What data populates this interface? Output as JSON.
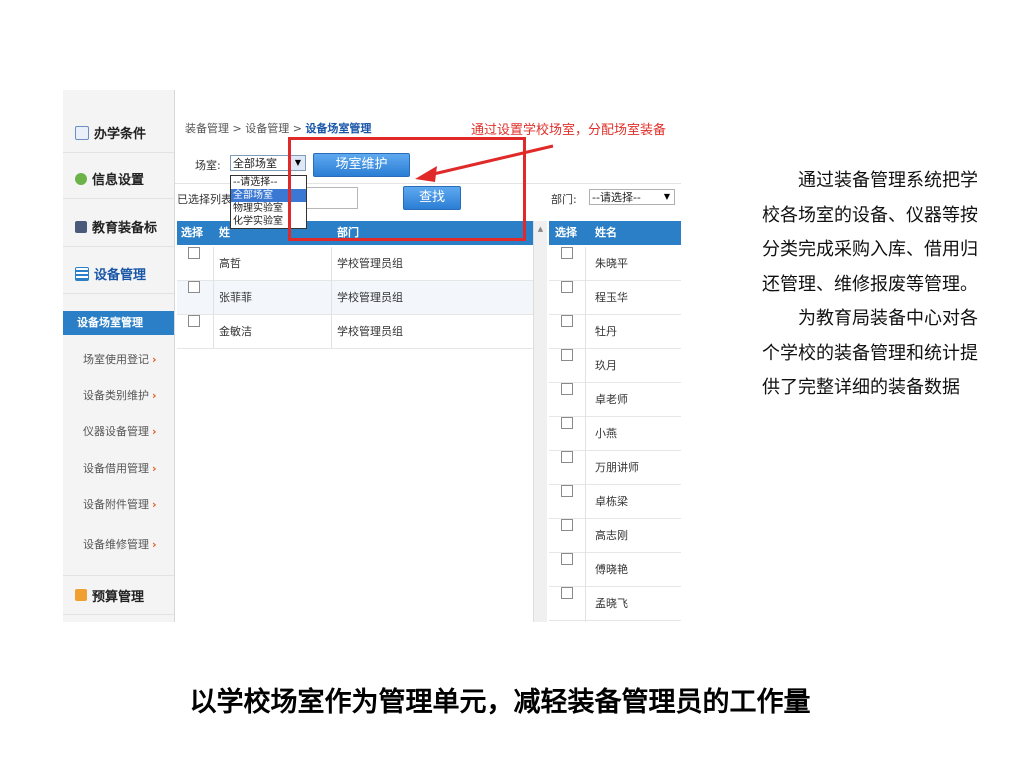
{
  "nav": {
    "sections": [
      "办学条件",
      "信息设置",
      "教育装备标",
      "设备管理",
      "预算管理"
    ],
    "active_item": "设备场室管理",
    "sub_items": [
      "场室使用登记",
      "设备类别维护",
      "仪器设备管理",
      "设备借用管理",
      "设备附件管理",
      "设备维修管理"
    ]
  },
  "breadcrumb": {
    "part1": "装备管理 > 设备管理 > ",
    "current": "设备场室管理"
  },
  "annotation": "通过设置学校场室，分配场室装备",
  "filter": {
    "room_label": "场室:",
    "room_selected": "全部场室",
    "maintain_button": "场室维护",
    "options": [
      "--请选择--",
      "全部场室",
      "物理实验室",
      "化学实验室"
    ],
    "selected_list_label": "已选择列表",
    "search_button": "查找",
    "dept_label": "部门:",
    "dept_selected": "--请选择--"
  },
  "left_table": {
    "headers": [
      "选择",
      "姓",
      "部门"
    ],
    "rows": [
      {
        "name": "高哲",
        "dept": "学校管理员组"
      },
      {
        "name": "张菲菲",
        "dept": "学校管理员组"
      },
      {
        "name": "金敏洁",
        "dept": "学校管理员组"
      }
    ]
  },
  "right_table": {
    "headers": [
      "选择",
      "姓名"
    ],
    "rows": [
      "朱晓平",
      "程玉华",
      "牡丹",
      "玖月",
      "卓老师",
      "小燕",
      "万朋讲师",
      "卓栋梁",
      "高志刚",
      "傅晓艳",
      "孟晓飞"
    ]
  },
  "description": {
    "p1": "通过装备管理系统把学校各场室的设备、仪器等按分类完成采购入库、借用归还管理、维修报废等管理。",
    "p2": "为教育局装备中心对各个学校的装备管理和统计提供了完整详细的装备数据"
  },
  "caption": "以学校场室作为管理单元，减轻装备管理员的工作量",
  "colors": {
    "accent": "#2a7fc6",
    "highlight": "#e02a2a"
  }
}
